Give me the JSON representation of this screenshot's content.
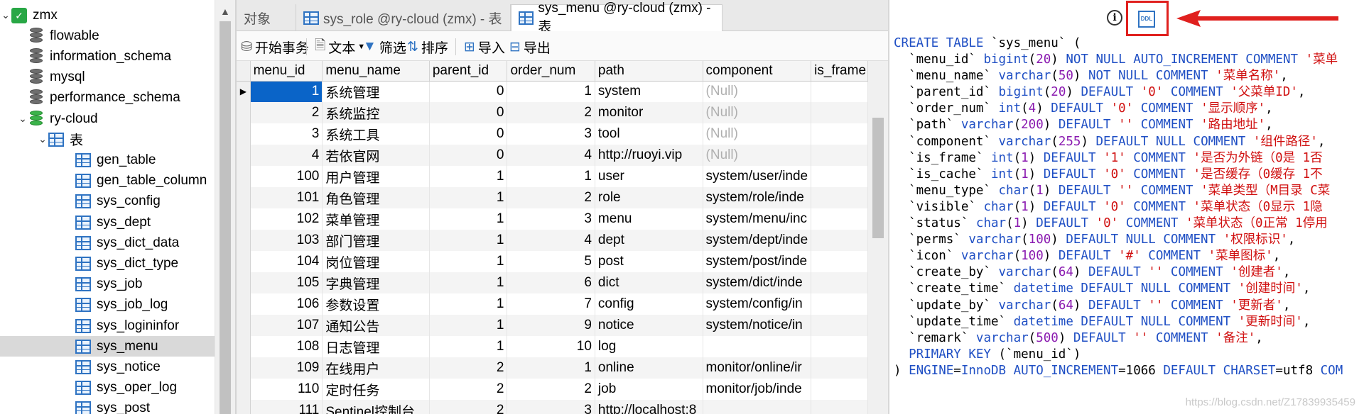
{
  "sidebar": {
    "items": [
      {
        "label": "zmx",
        "level": 0,
        "icon": "connection-icon",
        "expanded": true
      },
      {
        "label": "flowable",
        "level": 1,
        "icon": "database-icon"
      },
      {
        "label": "information_schema",
        "level": 1,
        "icon": "database-icon"
      },
      {
        "label": "mysql",
        "level": 1,
        "icon": "database-icon"
      },
      {
        "label": "performance_schema",
        "level": 1,
        "icon": "database-icon"
      },
      {
        "label": "ry-cloud",
        "level": 1,
        "icon": "database-open-icon",
        "expanded": true
      },
      {
        "label": "表",
        "level": 2,
        "icon": "tables-folder-icon",
        "expanded": true
      },
      {
        "label": "gen_table",
        "level": 3,
        "icon": "table-icon"
      },
      {
        "label": "gen_table_column",
        "level": 3,
        "icon": "table-icon"
      },
      {
        "label": "sys_config",
        "level": 3,
        "icon": "table-icon"
      },
      {
        "label": "sys_dept",
        "level": 3,
        "icon": "table-icon"
      },
      {
        "label": "sys_dict_data",
        "level": 3,
        "icon": "table-icon"
      },
      {
        "label": "sys_dict_type",
        "level": 3,
        "icon": "table-icon"
      },
      {
        "label": "sys_job",
        "level": 3,
        "icon": "table-icon"
      },
      {
        "label": "sys_job_log",
        "level": 3,
        "icon": "table-icon"
      },
      {
        "label": "sys_logininfor",
        "level": 3,
        "icon": "table-icon"
      },
      {
        "label": "sys_menu",
        "level": 3,
        "icon": "table-icon",
        "selected": true
      },
      {
        "label": "sys_notice",
        "level": 3,
        "icon": "table-icon"
      },
      {
        "label": "sys_oper_log",
        "level": 3,
        "icon": "table-icon"
      },
      {
        "label": "sys_post",
        "level": 3,
        "icon": "table-icon"
      }
    ]
  },
  "tabs": [
    {
      "label": "对象",
      "active": false
    },
    {
      "label": "sys_role @ry-cloud (zmx) - 表",
      "active": false
    },
    {
      "label": "sys_menu @ry-cloud (zmx) - 表",
      "active": true
    }
  ],
  "toolbar": {
    "begin_transaction": "开始事务",
    "text": "文本",
    "filter": "筛选",
    "sort": "排序",
    "import": "导入",
    "export": "导出"
  },
  "grid": {
    "columns": [
      "menu_id",
      "menu_name",
      "parent_id",
      "order_num",
      "path",
      "component",
      "is_frame"
    ],
    "rows": [
      [
        "1",
        "系统管理",
        "0",
        "1",
        "system",
        "(Null)",
        ""
      ],
      [
        "2",
        "系统监控",
        "0",
        "2",
        "monitor",
        "(Null)",
        ""
      ],
      [
        "3",
        "系统工具",
        "0",
        "3",
        "tool",
        "(Null)",
        ""
      ],
      [
        "4",
        "若依官网",
        "0",
        "4",
        "http://ruoyi.vip",
        "(Null)",
        ""
      ],
      [
        "100",
        "用户管理",
        "1",
        "1",
        "user",
        "system/user/inde",
        ""
      ],
      [
        "101",
        "角色管理",
        "1",
        "2",
        "role",
        "system/role/inde",
        ""
      ],
      [
        "102",
        "菜单管理",
        "1",
        "3",
        "menu",
        "system/menu/inc",
        ""
      ],
      [
        "103",
        "部门管理",
        "1",
        "4",
        "dept",
        "system/dept/inde",
        ""
      ],
      [
        "104",
        "岗位管理",
        "1",
        "5",
        "post",
        "system/post/inde",
        ""
      ],
      [
        "105",
        "字典管理",
        "1",
        "6",
        "dict",
        "system/dict/inde",
        ""
      ],
      [
        "106",
        "参数设置",
        "1",
        "7",
        "config",
        "system/config/in",
        ""
      ],
      [
        "107",
        "通知公告",
        "1",
        "9",
        "notice",
        "system/notice/in",
        ""
      ],
      [
        "108",
        "日志管理",
        "1",
        "10",
        "log",
        "",
        ""
      ],
      [
        "109",
        "在线用户",
        "2",
        "1",
        "online",
        "monitor/online/ir",
        ""
      ],
      [
        "110",
        "定时任务",
        "2",
        "2",
        "job",
        "monitor/job/inde",
        ""
      ],
      [
        "111",
        "Sentinel控制台",
        "2",
        "3",
        "http://localhost:8",
        "",
        ""
      ]
    ]
  },
  "ddl": {
    "info_icon": "ⓘ",
    "ddl_icon_label": "DDL",
    "arrow_color": "#e0201e",
    "lines": [
      "CREATE TABLE `sys_menu` (",
      "  `menu_id` bigint(20) NOT NULL AUTO_INCREMENT COMMENT '菜单",
      "  `menu_name` varchar(50) NOT NULL COMMENT '菜单名称',",
      "  `parent_id` bigint(20) DEFAULT '0' COMMENT '父菜单ID',",
      "  `order_num` int(4) DEFAULT '0' COMMENT '显示顺序',",
      "  `path` varchar(200) DEFAULT '' COMMENT '路由地址',",
      "  `component` varchar(255) DEFAULT NULL COMMENT '组件路径',",
      "  `is_frame` int(1) DEFAULT '1' COMMENT '是否为外链（0是 1否",
      "  `is_cache` int(1) DEFAULT '0' COMMENT '是否缓存（0缓存 1不",
      "  `menu_type` char(1) DEFAULT '' COMMENT '菜单类型（M目录 C菜",
      "  `visible` char(1) DEFAULT '0' COMMENT '菜单状态（0显示 1隐",
      "  `status` char(1) DEFAULT '0' COMMENT '菜单状态（0正常 1停用",
      "  `perms` varchar(100) DEFAULT NULL COMMENT '权限标识',",
      "  `icon` varchar(100) DEFAULT '#' COMMENT '菜单图标',",
      "  `create_by` varchar(64) DEFAULT '' COMMENT '创建者',",
      "  `create_time` datetime DEFAULT NULL COMMENT '创建时间',",
      "  `update_by` varchar(64) DEFAULT '' COMMENT '更新者',",
      "  `update_time` datetime DEFAULT NULL COMMENT '更新时间',",
      "  `remark` varchar(500) DEFAULT '' COMMENT '备注',",
      "  PRIMARY KEY (`menu_id`)",
      ") ENGINE=InnoDB AUTO_INCREMENT=1066 DEFAULT CHARSET=utf8 COM"
    ],
    "watermark": "https://blog.csdn.net/Z17839935459"
  }
}
